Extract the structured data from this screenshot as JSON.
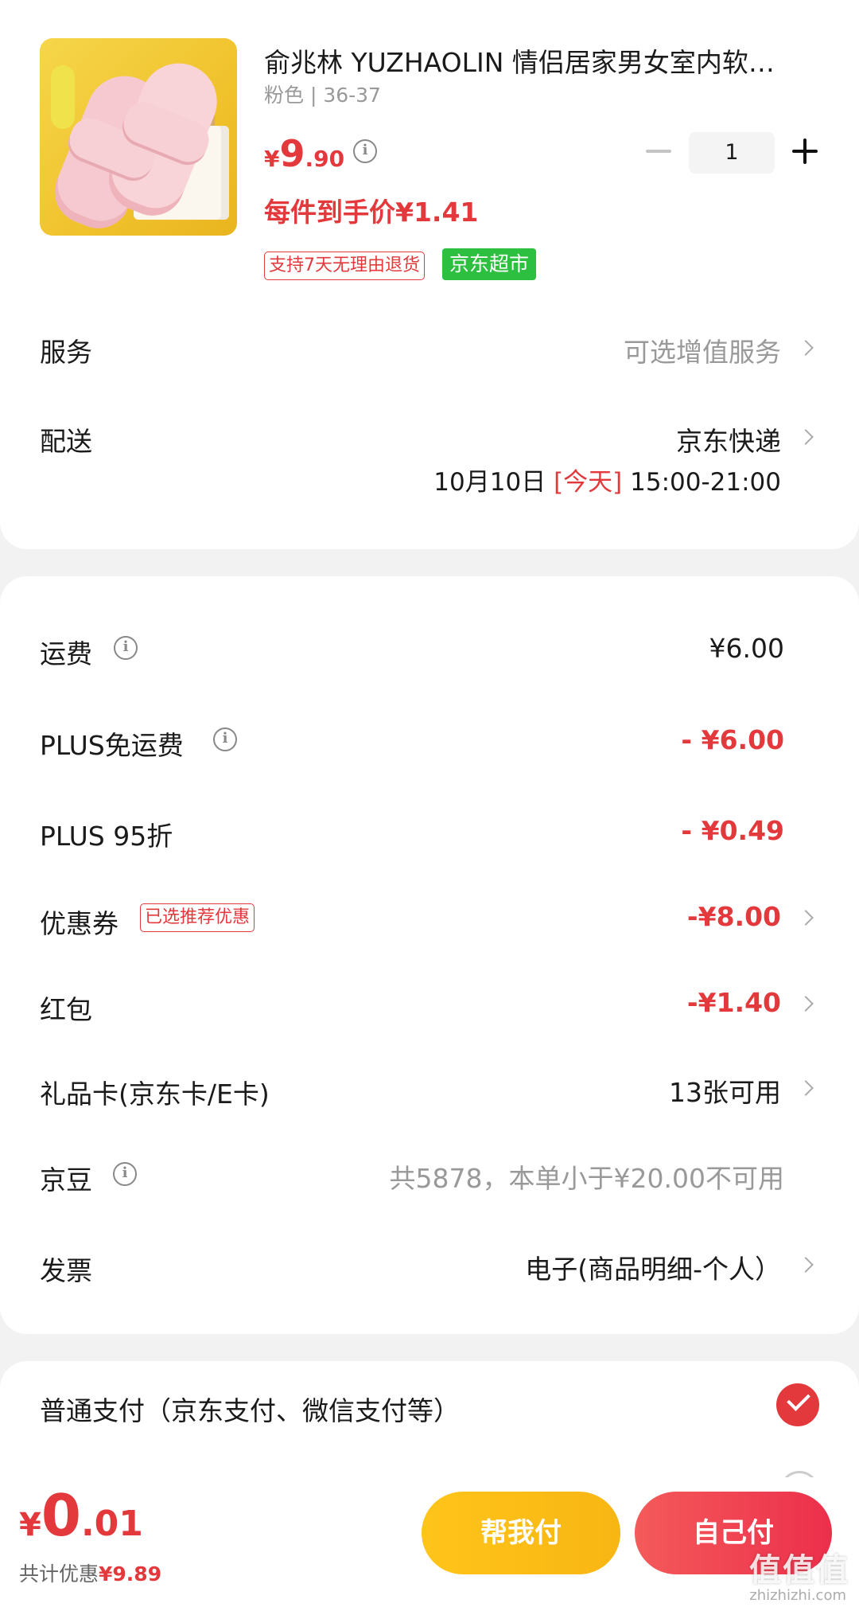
{
  "product": {
    "title": "俞兆林 YUZHAOLIN 情侣居家男女室内软…",
    "spec": "粉色 | 36-37",
    "price": {
      "currency": "¥",
      "integer": "9",
      "decimal": ".90"
    },
    "unit_price": "每件到手价¥1.41",
    "quantity": "1",
    "badges": {
      "return": "支持7天无理由退货",
      "market": "京东超市"
    }
  },
  "service": {
    "label": "服务",
    "value": "可选增值服务"
  },
  "delivery": {
    "label": "配送",
    "carrier": "京东快递",
    "date": "10月10日",
    "today": "[今天]",
    "time_window": "15:00-21:00"
  },
  "fees": [
    {
      "label": "运费",
      "value": "¥6.00"
    },
    {
      "label": "PLUS免运费",
      "value": "- ¥6.00"
    },
    {
      "label": "PLUS 95折",
      "value": "- ¥0.49"
    },
    {
      "label": "优惠券",
      "badge": "已选推荐优惠",
      "value": "-¥8.00"
    },
    {
      "label": "红包",
      "value": "-¥1.40"
    },
    {
      "label": "礼品卡(京东卡/E卡)",
      "value": "13张可用"
    },
    {
      "label": "京豆",
      "value": "共5878，本单小于¥20.00不可用"
    },
    {
      "label": "发票",
      "value": "电子(商品明细-个人）"
    }
  ],
  "payment": {
    "label": "普通支付（京东支付、微信支付等）"
  },
  "footer": {
    "total": {
      "currency": "¥",
      "integer": "0",
      "decimal": ".01"
    },
    "saved_label": "共计优惠",
    "saved_amount": "¥9.89",
    "help_pay": "帮我付",
    "self_pay": "自己付",
    "watermark": "值值值",
    "watermark_url": "zhizhizhi.com"
  },
  "colors": {
    "accent": "#e4393c",
    "green_badge": "#2dbf3f",
    "yellow_button": "#ffc41a",
    "red_button": "#ec2f4b"
  }
}
